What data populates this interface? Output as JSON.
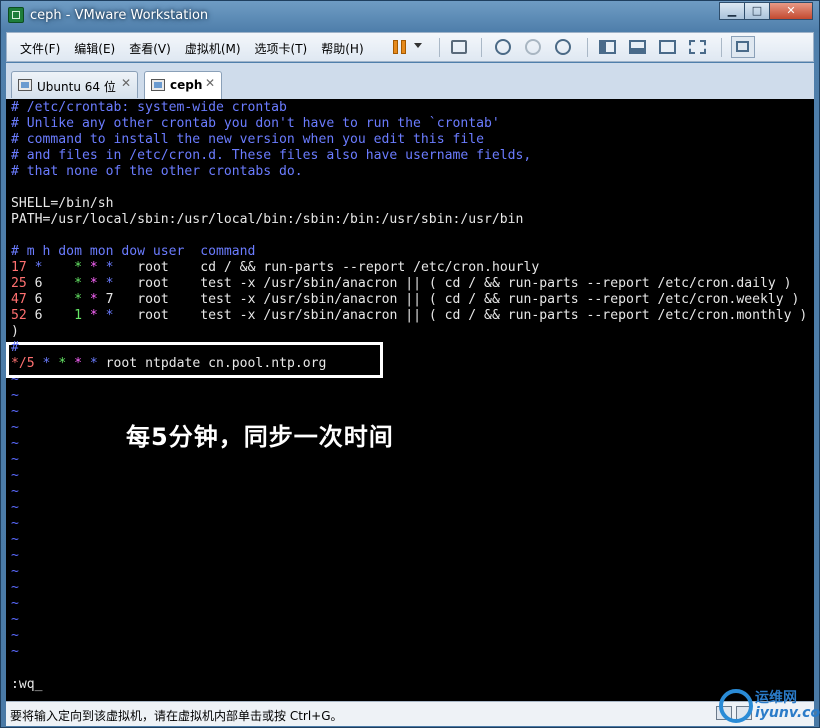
{
  "window": {
    "title": "ceph - VMware Workstation",
    "buttons": {
      "minimize": "▁",
      "maximize": "□",
      "close": "✕"
    }
  },
  "menubar": {
    "items": [
      "文件(F)",
      "编辑(E)",
      "查看(V)",
      "虚拟机(M)",
      "选项卡(T)",
      "帮助(H)"
    ]
  },
  "toolbar": {
    "icons": [
      "pause-icon",
      "dropdown-caret-icon",
      "network-icon",
      "snapshot-icon",
      "revert-snapshot-icon",
      "snapshot-manager-icon",
      "view-sidebar-icon",
      "view-console-icon",
      "fullscreen-icon",
      "unity-icon",
      "thumbnail-view-icon"
    ]
  },
  "tabs": [
    {
      "label": "Ubuntu 64 位",
      "close": "✕",
      "active": false
    },
    {
      "label": "ceph",
      "close": "✕",
      "active": true
    }
  ],
  "terminal": {
    "lines": [
      [
        {
          "t": "# /etc/crontab: system-wide crontab",
          "c": "blue"
        }
      ],
      [
        {
          "t": "# Unlike any other crontab you don't have to run the `crontab'",
          "c": "blue"
        }
      ],
      [
        {
          "t": "# command to install the new version when you edit this file",
          "c": "blue"
        }
      ],
      [
        {
          "t": "# and files in /etc/cron.d. These files also have username fields,",
          "c": "blue"
        }
      ],
      [
        {
          "t": "# that none of the other crontabs do.",
          "c": "blue"
        }
      ],
      [],
      [
        {
          "t": "SHELL=/bin/sh",
          "c": "white"
        }
      ],
      [
        {
          "t": "PATH=/usr/local/sbin:/usr/local/bin:/sbin:/bin:/usr/sbin:/usr/bin",
          "c": "white"
        }
      ],
      [],
      [
        {
          "t": "# m h dom mon dow user  command",
          "c": "blue"
        }
      ],
      [
        {
          "t": "17",
          "c": "red"
        },
        {
          "t": " *    ",
          "c": "blue"
        },
        {
          "t": "* ",
          "c": "green"
        },
        {
          "t": "* ",
          "c": "magenta"
        },
        {
          "t": "*   ",
          "c": "blue"
        },
        {
          "t": "root    cd / && run-parts --report /etc/cron.hourly",
          "c": "white"
        }
      ],
      [
        {
          "t": "25",
          "c": "red"
        },
        {
          "t": " 6    ",
          "c": "white"
        },
        {
          "t": "* ",
          "c": "green"
        },
        {
          "t": "* ",
          "c": "magenta"
        },
        {
          "t": "*   ",
          "c": "blue"
        },
        {
          "t": "root    test -x /usr/sbin/anacron || ( cd / && run-parts --report /etc/cron.daily )",
          "c": "white"
        }
      ],
      [
        {
          "t": "47",
          "c": "red"
        },
        {
          "t": " 6    ",
          "c": "white"
        },
        {
          "t": "* ",
          "c": "green"
        },
        {
          "t": "* ",
          "c": "magenta"
        },
        {
          "t": "7   ",
          "c": "white"
        },
        {
          "t": "root    test -x /usr/sbin/anacron || ( cd / && run-parts --report /etc/cron.weekly )",
          "c": "white"
        }
      ],
      [
        {
          "t": "52",
          "c": "red"
        },
        {
          "t": " 6    ",
          "c": "white"
        },
        {
          "t": "1 ",
          "c": "green"
        },
        {
          "t": "* ",
          "c": "magenta"
        },
        {
          "t": "*   ",
          "c": "blue"
        },
        {
          "t": "root    test -x /usr/sbin/anacron || ( cd / && run-parts --report /etc/cron.monthly )",
          "c": "white"
        }
      ],
      [
        {
          "t": ")",
          "c": "white"
        }
      ],
      [
        {
          "t": "#",
          "c": "blue"
        }
      ],
      [
        {
          "t": "*/5",
          "c": "red"
        },
        {
          "t": " * ",
          "c": "blue"
        },
        {
          "t": "* ",
          "c": "green"
        },
        {
          "t": "* ",
          "c": "magenta"
        },
        {
          "t": "* ",
          "c": "blue"
        },
        {
          "t": "root ntpdate cn.pool.ntp.org",
          "c": "white"
        }
      ]
    ],
    "tilde": "~",
    "command_line": ":wq_"
  },
  "annotation": {
    "text": "每5分钟，同步一次时间"
  },
  "statusbar": {
    "text": "要将输入定向到该虚拟机，请在虚拟机内部单击或按 Ctrl+G。"
  },
  "watermark": {
    "line1": "运维网",
    "line2": "iyunv.com"
  },
  "colors": {
    "blue": "#6b7cff",
    "white": "#e8e8e8",
    "red": "#ff7070",
    "green": "#66e866",
    "magenta": "#ff66ff",
    "terminal_bg": "#000000"
  }
}
